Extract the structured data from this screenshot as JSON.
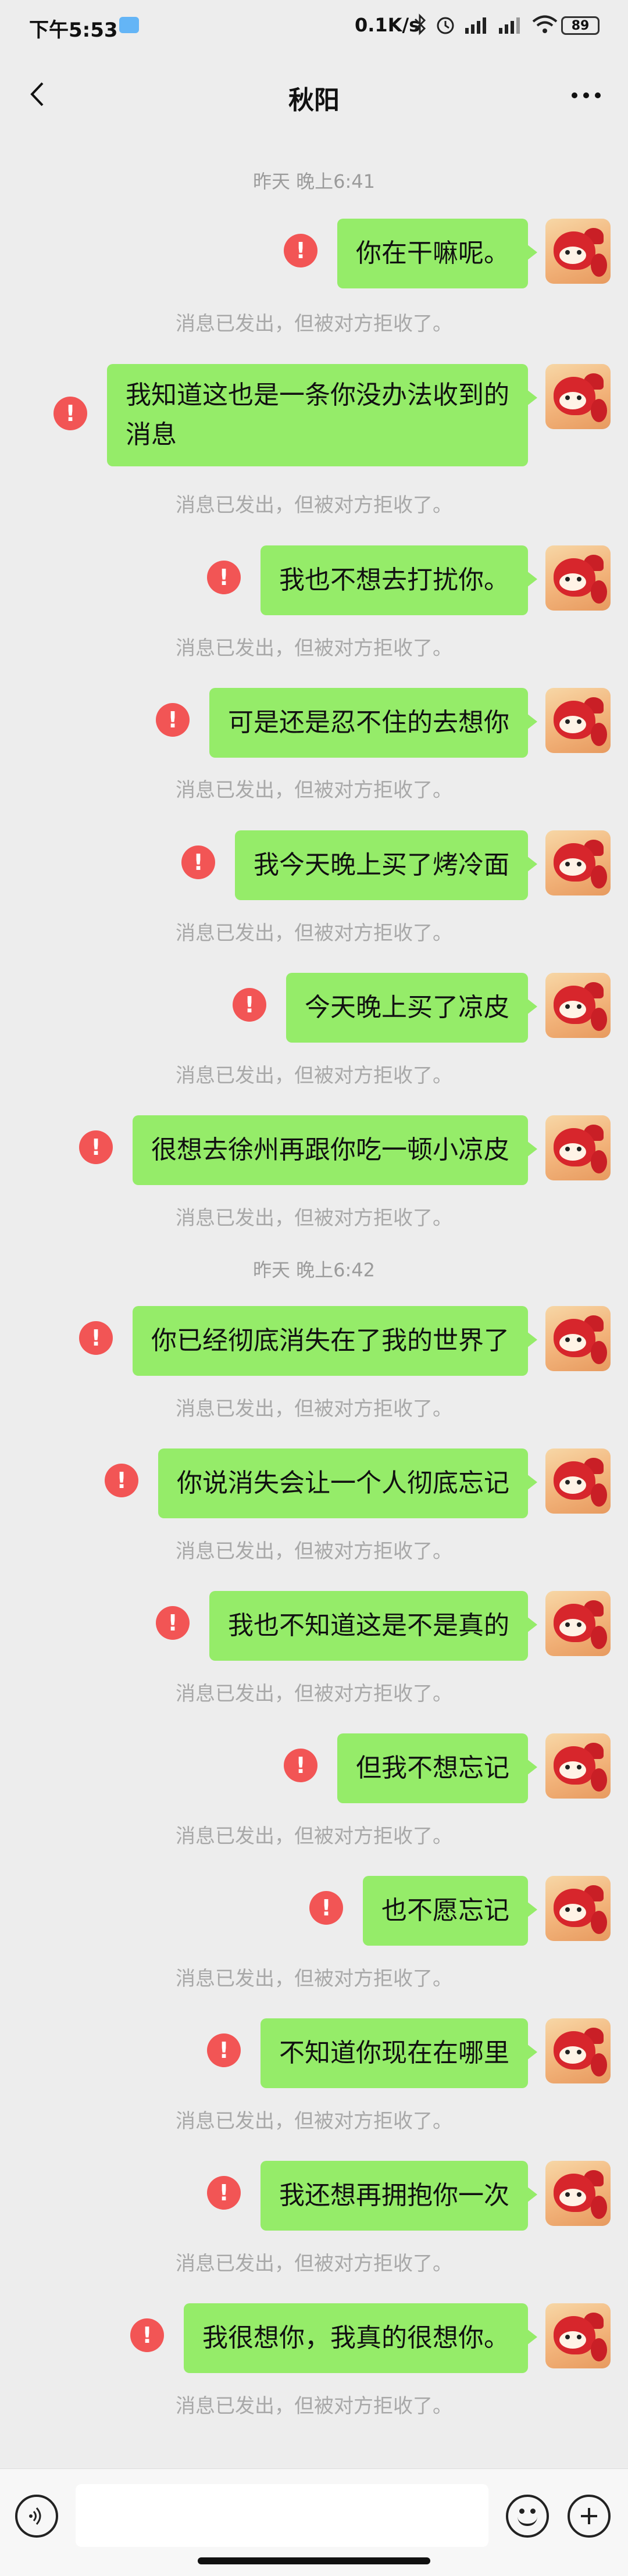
{
  "status_bar": {
    "time": "下午5:53",
    "net_speed": "0.1K/s",
    "battery": "89"
  },
  "nav": {
    "title": "秋阳"
  },
  "timestamps": [
    "昨天 晚上6:41",
    "昨天 晚上6:42"
  ],
  "rejected_text": "消息已发出，但被对方拒收了。",
  "messages": [
    {
      "text": "你在干嘛呢。"
    },
    {
      "text": "我知道这也是一条你没办法收到的\n消息"
    },
    {
      "text": "我也不想去打扰你。"
    },
    {
      "text": "可是还是忍不住的去想你"
    },
    {
      "text": "我今天晚上买了烤冷面"
    },
    {
      "text": "今天晚上买了凉皮"
    },
    {
      "text": "很想去徐州再跟你吃一顿小凉皮"
    },
    {
      "text": "你已经彻底消失在了我的世界了"
    },
    {
      "text": "你说消失会让一个人彻底忘记"
    },
    {
      "text": "我也不知道这是不是真的"
    },
    {
      "text": "但我不想忘记"
    },
    {
      "text": "也不愿忘记"
    },
    {
      "text": "不知道你现在在哪里"
    },
    {
      "text": "我还想再拥抱你一次"
    },
    {
      "text": "我很想你，我真的很想你。"
    }
  ],
  "error_mark": "!",
  "input": {
    "value": "",
    "placeholder": ""
  },
  "icons": {
    "back": "back-arrow-icon",
    "more": "more-dots-icon",
    "voice": "voice-icon",
    "emoji": "emoji-icon",
    "plus": "plus-icon"
  }
}
